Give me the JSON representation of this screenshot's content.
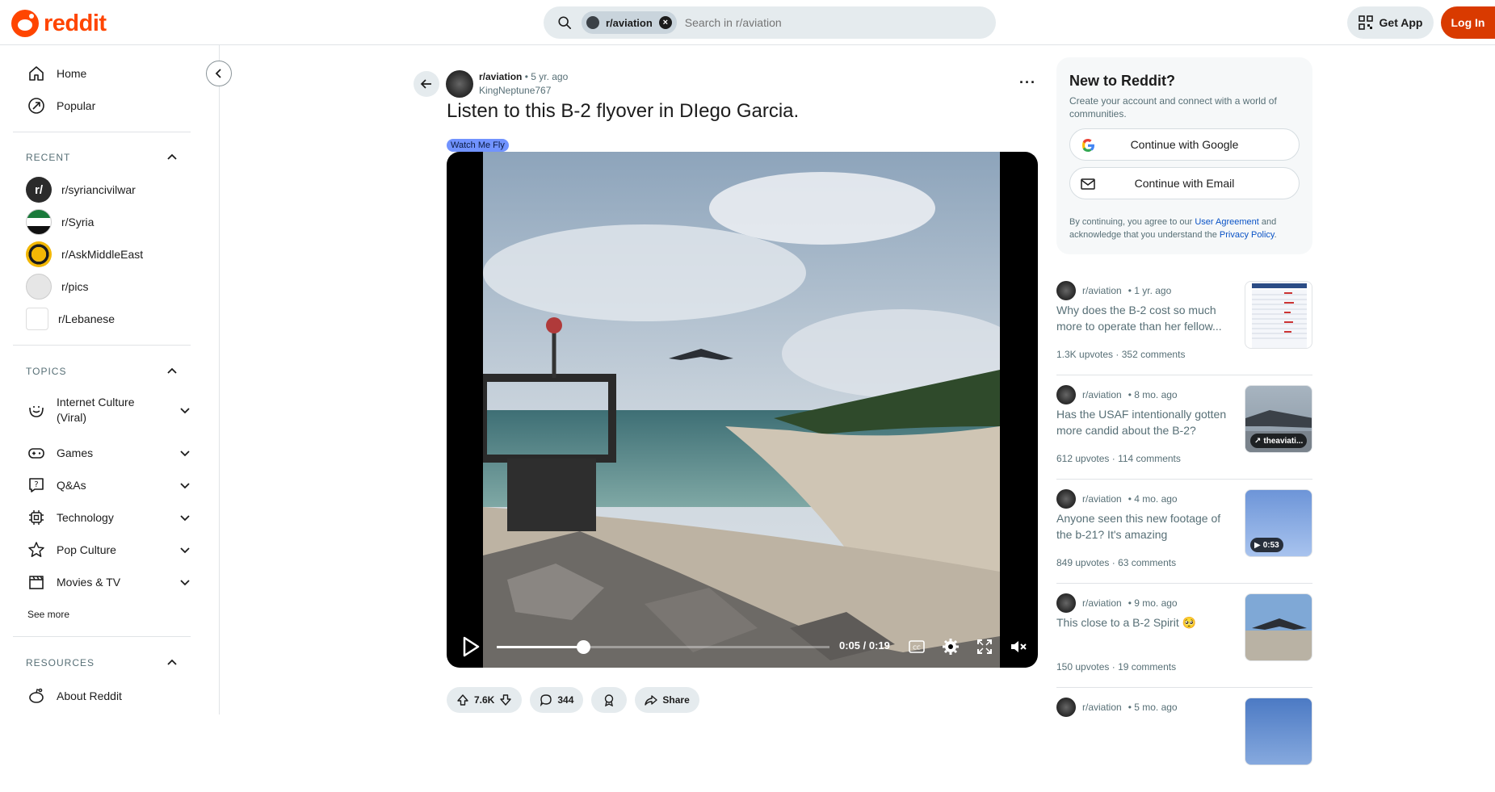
{
  "header": {
    "logo_text": "reddit",
    "search_chip": "r/aviation",
    "search_placeholder": "Search in r/aviation",
    "get_app_label": "Get App",
    "login_label": "Log In"
  },
  "sidebar": {
    "nav": [
      {
        "label": "Home",
        "icon": "home-icon"
      },
      {
        "label": "Popular",
        "icon": "popular-icon"
      }
    ],
    "recent_heading": "RECENT",
    "recent": [
      {
        "label": "r/syriancivilwar",
        "color": "#2b2b2b"
      },
      {
        "label": "r/Syria",
        "color": "#1a7a3a"
      },
      {
        "label": "r/AskMiddleEast",
        "color": "#f2b705"
      },
      {
        "label": "r/pics",
        "color": "#d8d8d8"
      },
      {
        "label": "r/Lebanese",
        "color": "#e8e8e8"
      }
    ],
    "topics_heading": "TOPICS",
    "topics": [
      {
        "label": "Internet Culture (Viral)",
        "icon": "smile-icon"
      },
      {
        "label": "Games",
        "icon": "gamepad-icon"
      },
      {
        "label": "Q&As",
        "icon": "question-icon"
      },
      {
        "label": "Technology",
        "icon": "chip-icon"
      },
      {
        "label": "Pop Culture",
        "icon": "star-icon"
      },
      {
        "label": "Movies & TV",
        "icon": "clapper-icon"
      }
    ],
    "see_more": "See more",
    "resources_heading": "RESOURCES",
    "resources": [
      {
        "label": "About Reddit",
        "icon": "reddit-icon"
      }
    ]
  },
  "post": {
    "subreddit": "r/aviation",
    "age": "• 5 yr. ago",
    "author": "KingNeptune767",
    "title": "Listen to this B-2 flyover in DIego Garcia.",
    "flair": "Watch Me Fly",
    "video": {
      "time": "0:05 / 0:19",
      "progress": 0.26
    },
    "actions": {
      "votes": "7.6K",
      "comments": "344",
      "share": "Share"
    }
  },
  "signup": {
    "title": "New to Reddit?",
    "subtitle": "Create your account and connect with a world of communities.",
    "google_label": "Continue with Google",
    "email_label": "Continue with Email",
    "legal_prefix": "By continuing, you agree to our ",
    "legal_link1": "User Agreement",
    "legal_mid": " and acknowledge that you understand the ",
    "legal_link2": "Privacy Policy",
    "legal_suffix": "."
  },
  "related": [
    {
      "subreddit": "r/aviation",
      "age": "• 1 yr. ago",
      "title": "Why does the B-2 cost so much more to operate than her fellow...",
      "upvotes": "1.3K upvotes",
      "comments": "352 comments",
      "badge": ""
    },
    {
      "subreddit": "r/aviation",
      "age": "• 8 mo. ago",
      "title": "Has the USAF intentionally gotten more candid about the B-2?",
      "upvotes": "612 upvotes",
      "comments": "114 comments",
      "badge": "theaviati..."
    },
    {
      "subreddit": "r/aviation",
      "age": "• 4 mo. ago",
      "title": "Anyone seen this new footage of the b-21? It's amazing",
      "upvotes": "849 upvotes",
      "comments": "63 comments",
      "badge": "0:53"
    },
    {
      "subreddit": "r/aviation",
      "age": "• 9 mo. ago",
      "title": "This close to a B-2 Spirit 🥺",
      "upvotes": "150 upvotes",
      "comments": "19 comments",
      "badge": ""
    },
    {
      "subreddit": "r/aviation",
      "age": "• 5 mo. ago",
      "title": "",
      "upvotes": "",
      "comments": "",
      "badge": ""
    }
  ]
}
